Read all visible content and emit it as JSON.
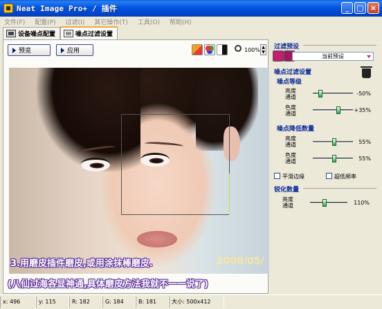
{
  "window": {
    "title": "Neat Image Pro+ / 插件"
  },
  "menu": [
    "文件(F)",
    "配置(P)",
    "过滤(I)",
    "其它操作(T)",
    "工具(O)",
    "帮助(H)"
  ],
  "tabs": [
    {
      "label": "设备噪点配置",
      "active": false
    },
    {
      "label": "噪点过滤设置",
      "active": true
    }
  ],
  "toolbar": {
    "preview_label": "预览",
    "apply_label": "应用",
    "zoom": "100%"
  },
  "caption": {
    "line1": "3.用磨皮插件磨皮,或用涂抹棒磨皮.",
    "date": "2008/05/",
    "line2": "(八仙过海各显神通,具体磨皮方法我就不一一说了)"
  },
  "panel": {
    "preset_title": "过滤预设",
    "preset_value": "当前预设",
    "filter_title": "噪点过滤设置",
    "noise_level": {
      "title": "噪点等级",
      "rows": [
        {
          "label": "亮度通道",
          "value": "-50%",
          "position": 0.15
        },
        {
          "label": "色度通道",
          "value": "+35%",
          "position": 0.6
        }
      ]
    },
    "noise_reduction": {
      "title": "噪点降低数量",
      "rows": [
        {
          "label": "亮度通道",
          "value": "55%",
          "position": 0.55
        },
        {
          "label": "色度通道",
          "value": "55%",
          "position": 0.55
        }
      ]
    },
    "smooth_edges": "平滑边缘",
    "ultra_low": "超低频率",
    "sharpen": {
      "title": "锐化数量",
      "rows": [
        {
          "label": "亮度通道",
          "value": "110%",
          "position": 0.35
        }
      ]
    }
  },
  "status": {
    "x": "x: 496",
    "y": "y: 115",
    "r": "R: 182",
    "g": "G: 184",
    "b": "B: 181",
    "size": "大小: 500x412"
  }
}
